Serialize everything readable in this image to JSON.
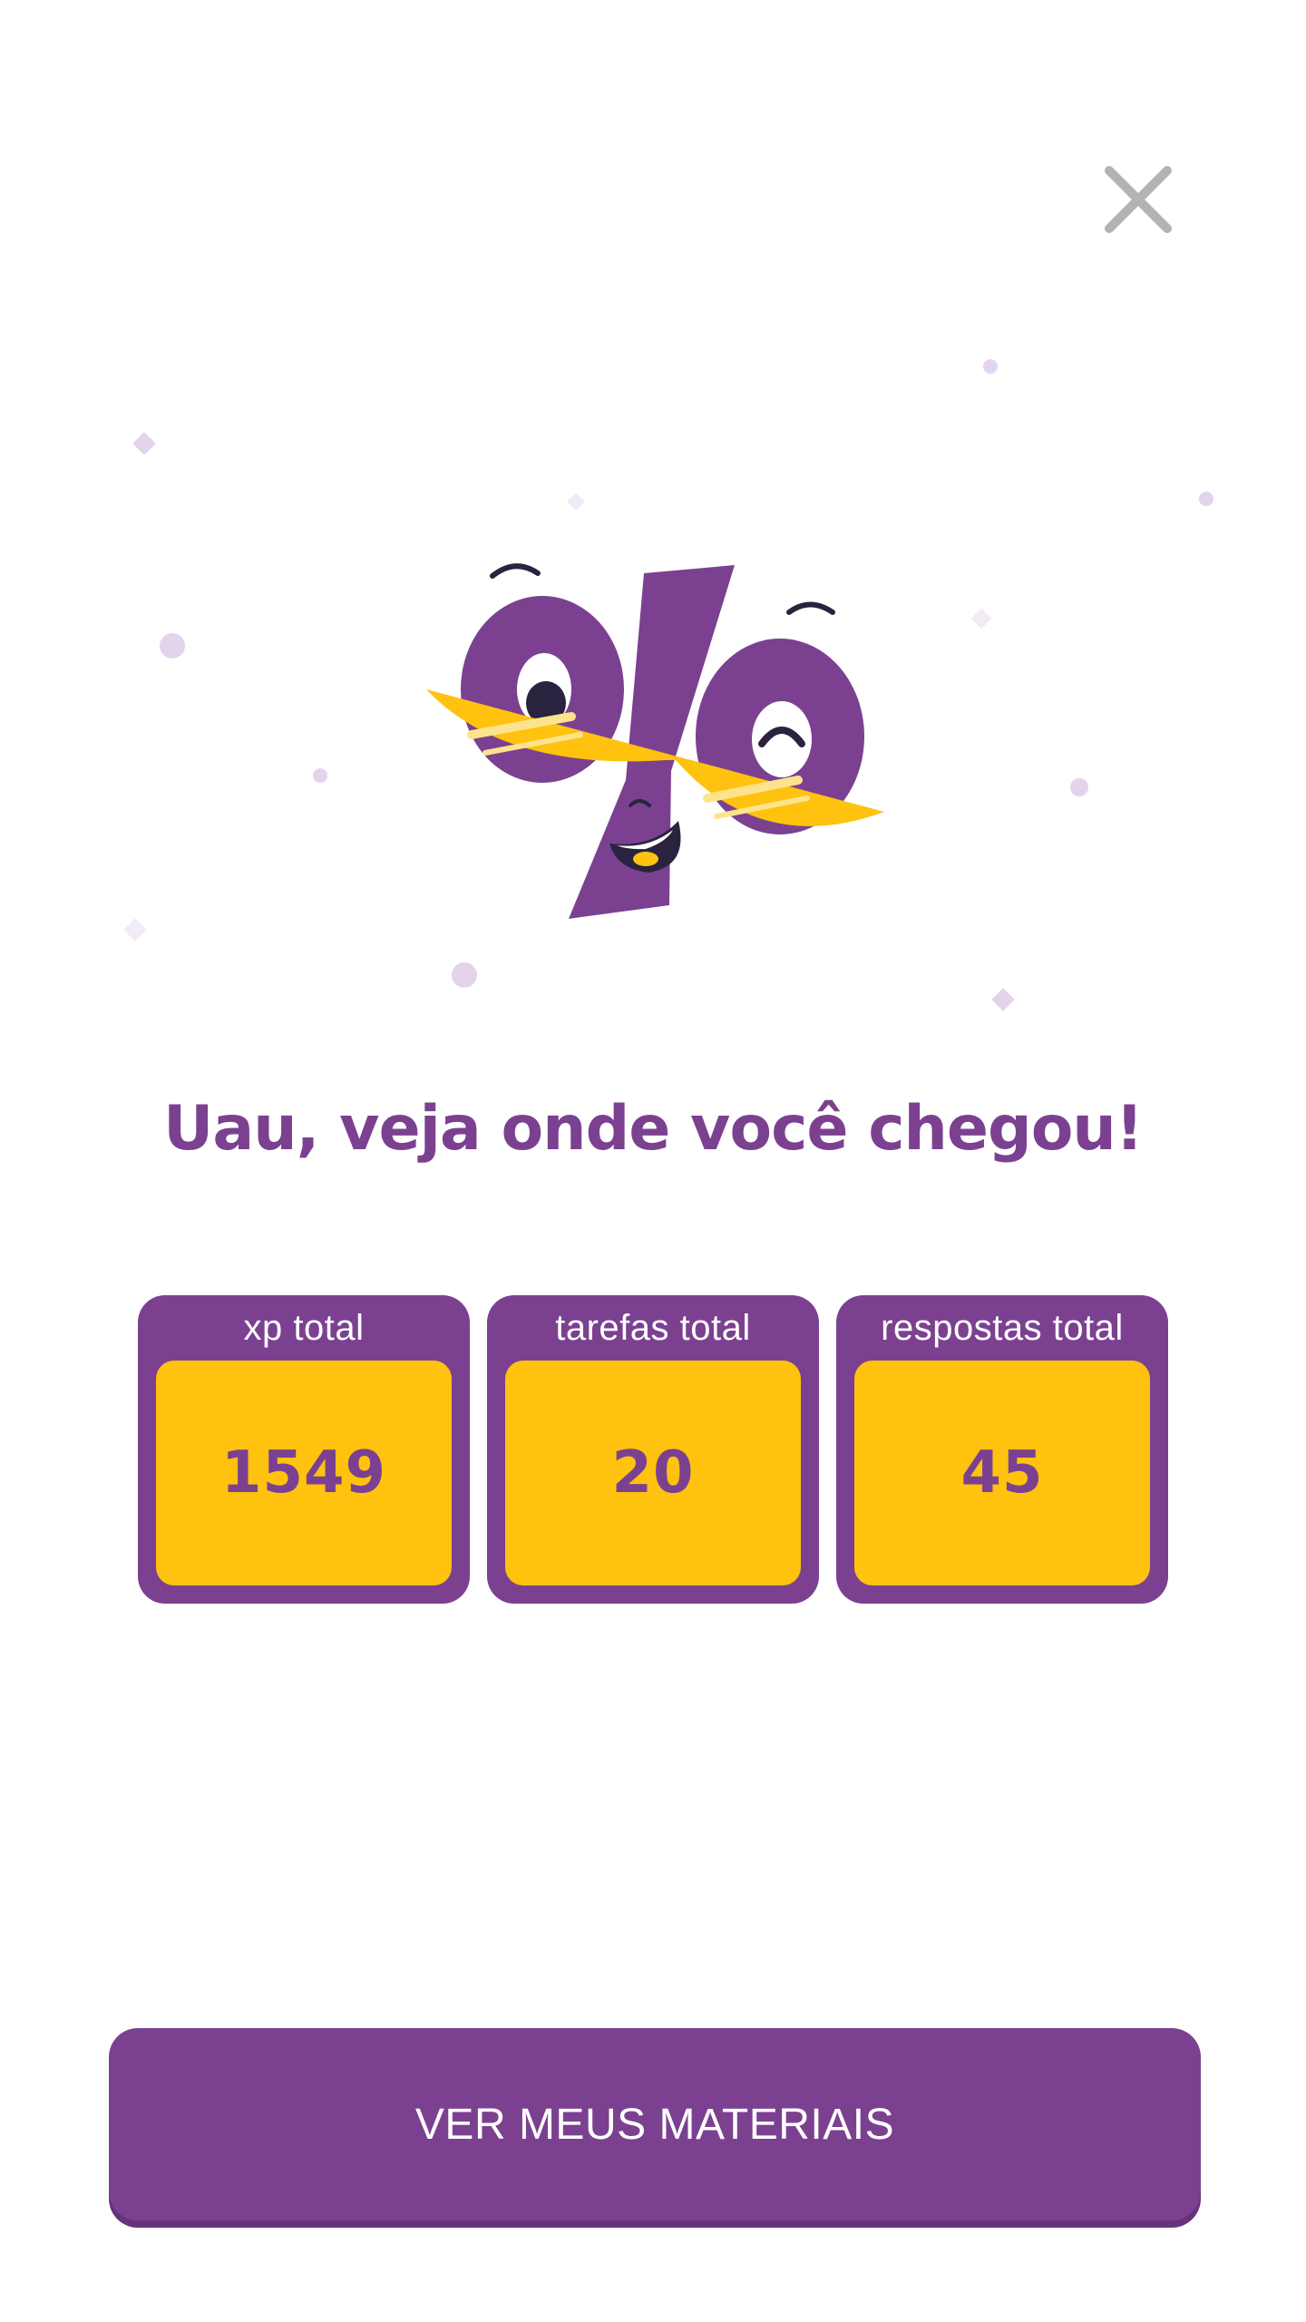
{
  "close": {
    "icon": "close-icon",
    "color": "#b3b3b3"
  },
  "mascot": {
    "icon": "percent-mascot-with-sunglasses"
  },
  "headline": "Uau, veja onde você chegou!",
  "stats": [
    {
      "label": "xp total",
      "value": "1549"
    },
    {
      "label": "tarefas total",
      "value": "20"
    },
    {
      "label": "respostas total",
      "value": "45"
    }
  ],
  "cta": {
    "label": "VER MEUS MATERIAIS"
  },
  "colors": {
    "purple": "#7b4190",
    "yellow": "#fec20f",
    "confetti": "#e4d3ec"
  }
}
